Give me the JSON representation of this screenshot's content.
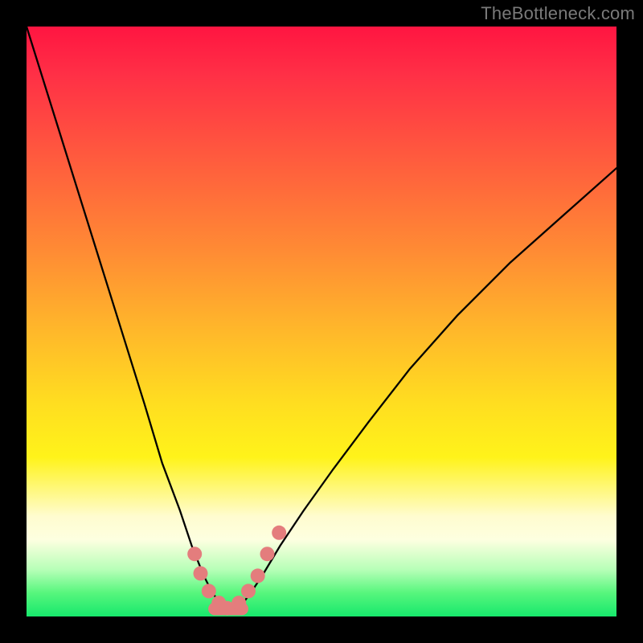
{
  "watermark_text": "TheBottleneck.com",
  "chart_data": {
    "type": "line",
    "title": "",
    "xlabel": "",
    "ylabel": "",
    "xlim": [
      0,
      100
    ],
    "ylim": [
      0,
      100
    ],
    "grid": false,
    "note": "Axes are unlabeled in the source image; x is a normalized horizontal position (0–100 left→right), y is a normalized vertical position (0 = bottom edge, 100 = top edge). The curve resembles a V-shaped bottleneck curve with its minimum near x ≈ 34.",
    "series": [
      {
        "name": "bottleneck-curve",
        "x": [
          0,
          5,
          10,
          15,
          20,
          23,
          26,
          28,
          30,
          31.5,
          33,
          34,
          35,
          36.5,
          38,
          40,
          43,
          47,
          52,
          58,
          65,
          73,
          82,
          91,
          100
        ],
        "y": [
          100,
          84,
          68,
          52,
          36,
          26,
          18,
          12,
          7,
          4,
          2,
          1.3,
          1.3,
          2,
          4,
          7,
          12,
          18,
          25,
          33,
          42,
          51,
          60,
          68,
          76
        ]
      }
    ],
    "markers": {
      "name": "trough-dots",
      "note": "Salmon circular markers clustered around the curve minimum.",
      "x": [
        28.5,
        29.5,
        30.9,
        32.6,
        34.0,
        36.0,
        37.6,
        39.2,
        40.8,
        42.8
      ],
      "y": [
        10.6,
        7.3,
        4.3,
        2.3,
        1.4,
        2.3,
        4.3,
        6.9,
        10.6,
        14.2
      ]
    },
    "trough_bar": {
      "note": "Rounded salmon bar along the flat bottom of the V.",
      "x_start": 30.8,
      "x_end": 37.6,
      "y": 1.3
    },
    "colors": {
      "curve": "#000000",
      "markers": "#e47d7d",
      "gradient_top": "#ff1541",
      "gradient_mid": "#fff31a",
      "gradient_bottom": "#17e86c",
      "frame": "#000000",
      "watermark": "#7a7a7a"
    }
  }
}
